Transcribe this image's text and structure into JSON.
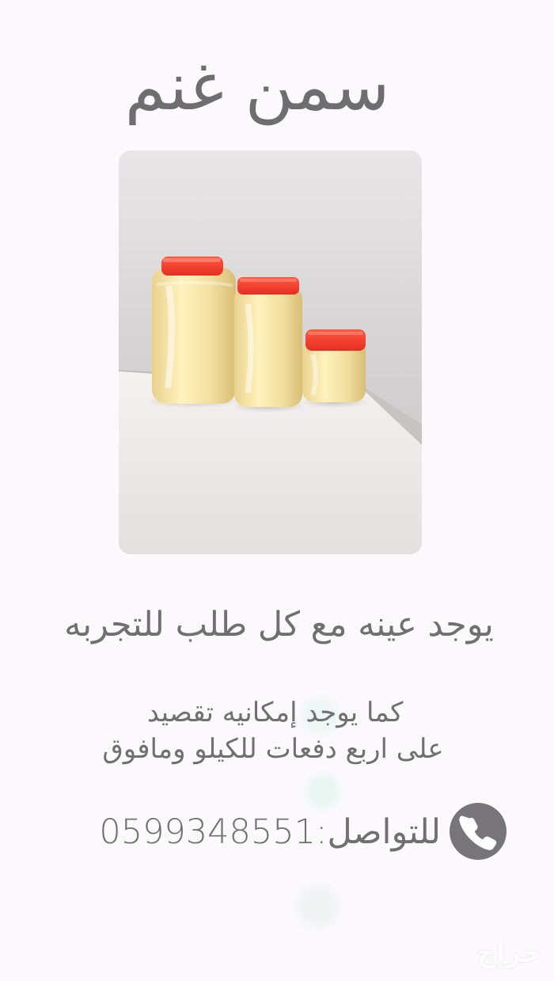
{
  "page": {
    "title": "سمن غنم",
    "sample_text": "يوجد عينه مع كل طلب للتجربه",
    "installment_line_1": "كما يوجد إمكانيه تقصيد",
    "installment_line_2": "على اربع دفعات للكيلو ومافوق",
    "contact_text": "للتواصل:0599348551",
    "watermark": "حراج"
  },
  "colors": {
    "text": "#707073",
    "background": "#fbf9fc",
    "jar_lid": "#f13d2d",
    "butter": "#f4e2a6",
    "phone_icon_bg": "#777579"
  },
  "icons": {
    "phone": "phone-icon"
  }
}
